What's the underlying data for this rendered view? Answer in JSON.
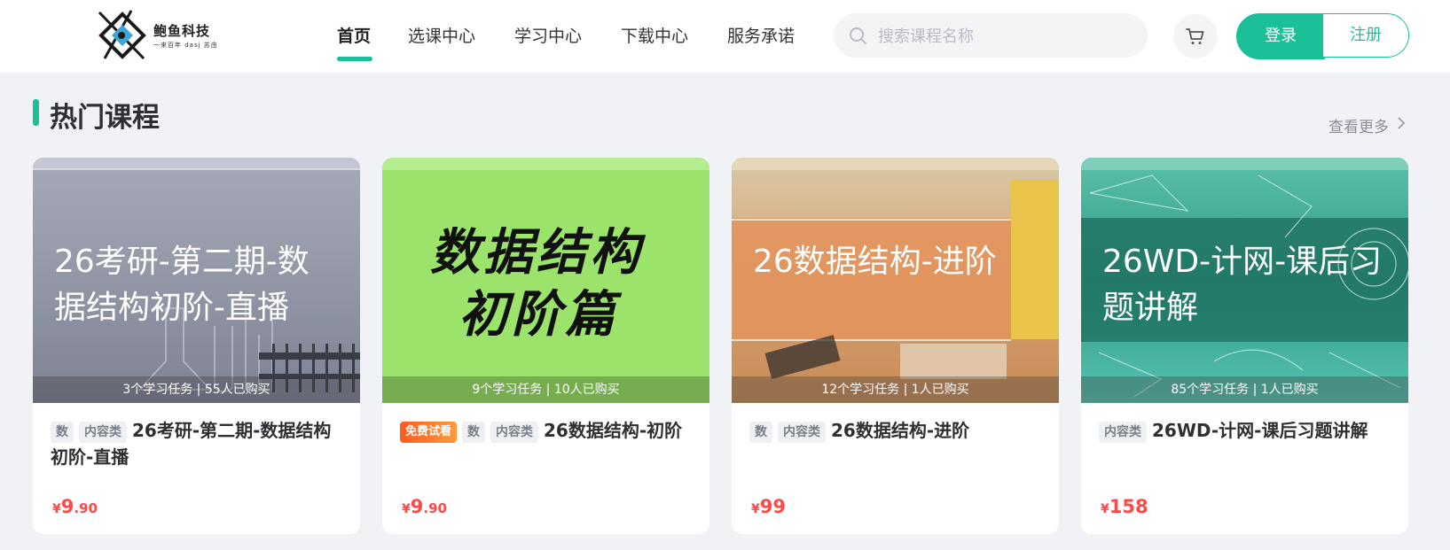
{
  "header": {
    "logo_text": "鲍鱼科技",
    "logo_sub": "一来百年 dasj 苏由",
    "nav": [
      {
        "label": "首页",
        "active": true
      },
      {
        "label": "选课中心",
        "active": false
      },
      {
        "label": "学习中心",
        "active": false
      },
      {
        "label": "下载中心",
        "active": false
      },
      {
        "label": "服务承诺",
        "active": false
      }
    ],
    "search_placeholder": "搜索课程名称",
    "login_label": "登录",
    "register_label": "注册",
    "accent_color": "#1bbf98"
  },
  "section": {
    "title": "热门课程",
    "see_more": "查看更多"
  },
  "courses": [
    {
      "cover_title": "26考研-第二期-数据结构初阶-直播",
      "cover_meta": "3个学习任务 | 55人已购买",
      "tags": [
        "数",
        "内容类"
      ],
      "free_trial": "",
      "title": "26考研-第二期-数据结构初阶-直播",
      "price_symbol": "¥",
      "price_int": "9",
      "price_dec": ".90"
    },
    {
      "cover_title": "数据结构初阶篇",
      "cover_line1": "数据结构",
      "cover_line2": "初阶篇",
      "cover_meta": "9个学习任务 | 10人已购买",
      "tags": [
        "数",
        "内容类"
      ],
      "free_trial": "免费试看",
      "title": "26数据结构-初阶",
      "price_symbol": "¥",
      "price_int": "9",
      "price_dec": ".90"
    },
    {
      "cover_title": "26数据结构-进阶",
      "cover_meta": "12个学习任务 | 1人已购买",
      "tags": [
        "数",
        "内容类"
      ],
      "free_trial": "",
      "title": "26数据结构-进阶",
      "price_symbol": "¥",
      "price_int": "99",
      "price_dec": ""
    },
    {
      "cover_title": "26WD-计网-课后习题讲解",
      "cover_meta": "85个学习任务 | 1人已购买",
      "tags": [
        "内容类"
      ],
      "free_trial": "",
      "title": "26WD-计网-课后习题讲解",
      "price_symbol": "¥",
      "price_int": "158",
      "price_dec": ""
    }
  ]
}
